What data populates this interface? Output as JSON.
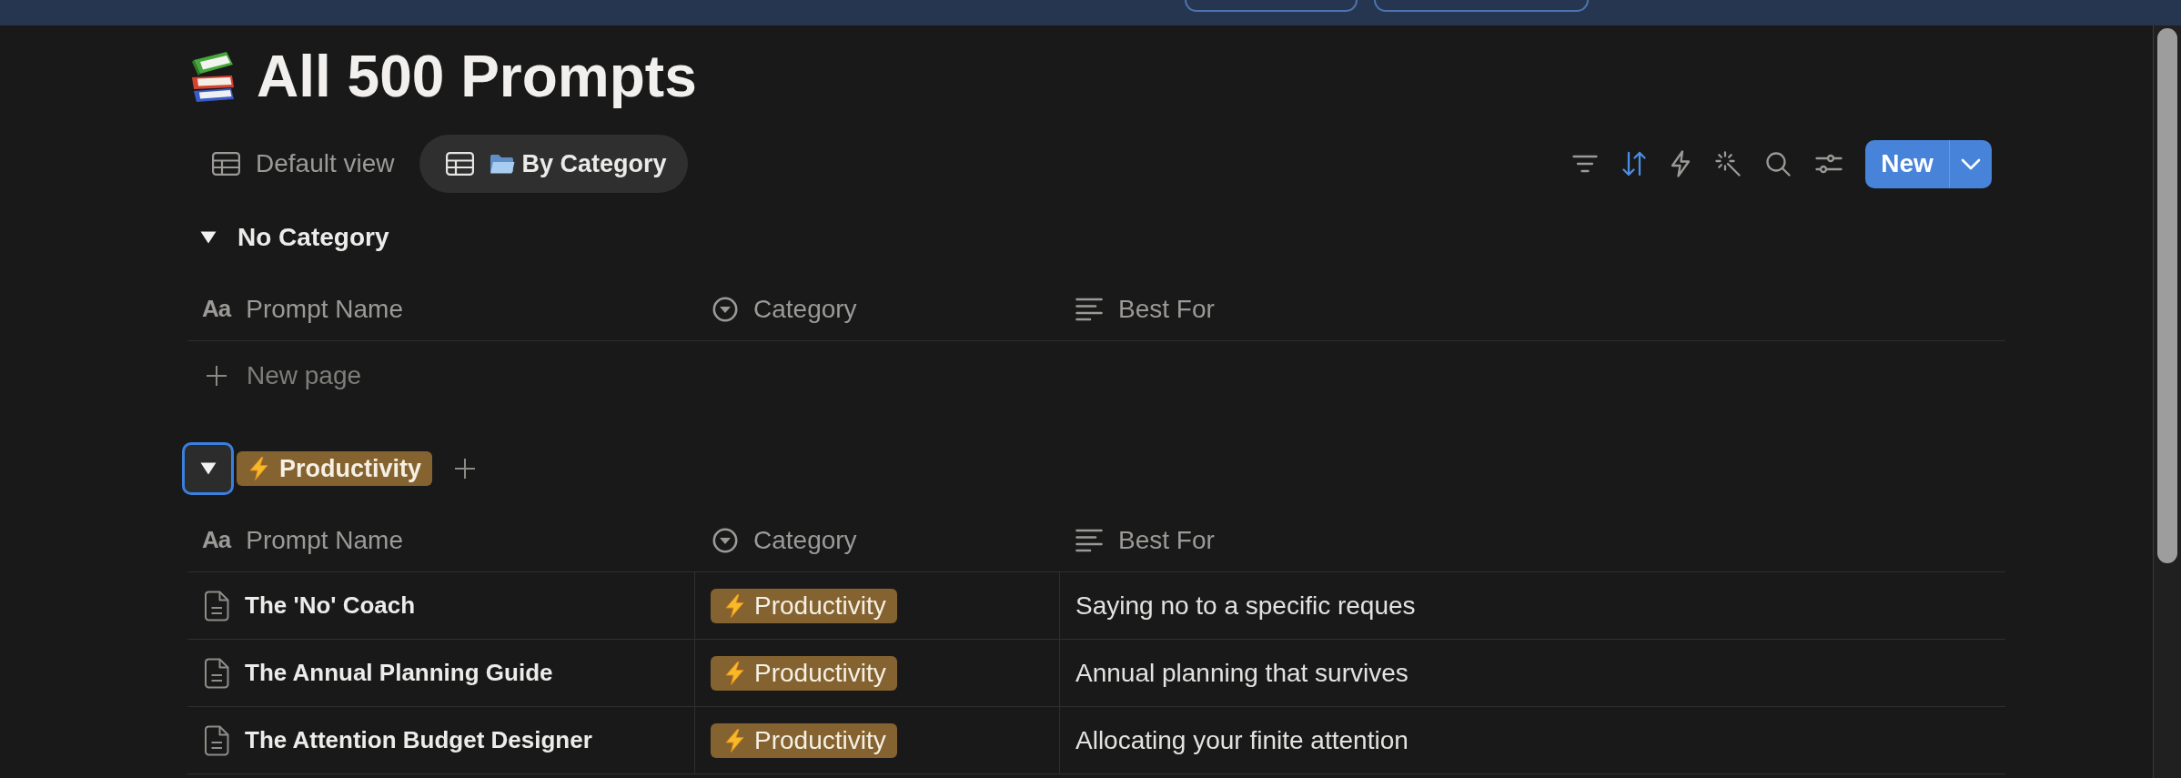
{
  "top_bar": {
    "buttons": [
      {
        "kind": "outlined"
      },
      {
        "kind": "outlined"
      }
    ]
  },
  "page": {
    "title": "All 500 Prompts"
  },
  "views": [
    {
      "kind": "table",
      "label": "Default view",
      "selected": false
    },
    {
      "kind": "grouped_table",
      "label": "By Category",
      "selected": true
    }
  ],
  "toolbar": {
    "actions": [
      {
        "kind": "filter",
        "active": false
      },
      {
        "kind": "sort",
        "active": true
      },
      {
        "kind": "automation",
        "active": false
      },
      {
        "kind": "ai",
        "active": false
      },
      {
        "kind": "search",
        "active": false
      },
      {
        "kind": "settings",
        "active": false
      }
    ],
    "new_button": {
      "label": "New"
    }
  },
  "groups": [
    {
      "label": "No Category",
      "expanded": true,
      "focused": false,
      "add_button": false,
      "columns": [
        {
          "kind": "title",
          "glyph": "Aa",
          "label": "Prompt Name"
        },
        {
          "kind": "select",
          "label": "Category"
        },
        {
          "kind": "text",
          "label": "Best For"
        }
      ],
      "new_row": {
        "label": "New page"
      }
    },
    {
      "tag": {
        "label": "Productivity",
        "color": "#846331"
      },
      "expanded": true,
      "focused": true,
      "add_button": true,
      "columns": [
        {
          "kind": "title",
          "glyph": "Aa",
          "label": "Prompt Name"
        },
        {
          "kind": "select",
          "label": "Category"
        },
        {
          "kind": "text",
          "label": "Best For"
        }
      ],
      "rows": [
        {
          "name": "The 'No' Coach",
          "category": {
            "label": "Productivity",
            "color": "#846331"
          },
          "best_for": "Saying no to a specific reques"
        },
        {
          "name": "The Annual Planning Guide",
          "category": {
            "label": "Productivity",
            "color": "#846331"
          },
          "best_for": "Annual planning that survives"
        },
        {
          "name": "The Attention Budget Designer",
          "category": {
            "label": "Productivity",
            "color": "#846331"
          },
          "best_for": "Allocating your finite attention"
        }
      ]
    }
  ]
}
